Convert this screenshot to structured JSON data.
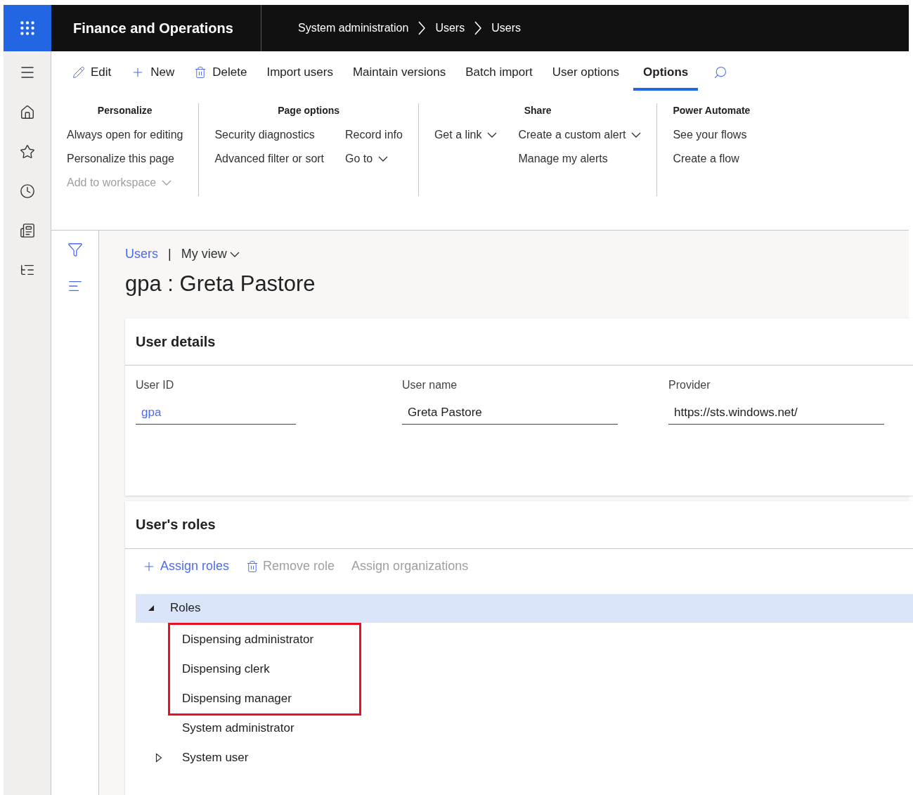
{
  "header": {
    "app_title": "Finance and Operations",
    "breadcrumb": [
      "System administration",
      "Users",
      "Users"
    ]
  },
  "action_pane": [
    {
      "label": "Edit",
      "kind": "edit",
      "selected": false
    },
    {
      "label": "New",
      "kind": "new",
      "selected": false
    },
    {
      "label": "Delete",
      "kind": "delete",
      "selected": false
    },
    {
      "label": "Import users",
      "kind": "text",
      "selected": false
    },
    {
      "label": "Maintain versions",
      "kind": "text",
      "selected": false
    },
    {
      "label": "Batch import",
      "kind": "text",
      "selected": false
    },
    {
      "label": "User options",
      "kind": "text",
      "selected": false
    },
    {
      "label": "Options",
      "kind": "text",
      "selected": true
    }
  ],
  "ribbon_groups": [
    {
      "title": "Personalize",
      "columns": [
        [
          {
            "label": "Always open for editing",
            "disabled": false,
            "dropdown": false
          },
          {
            "label": "Personalize this page",
            "disabled": false,
            "dropdown": false
          },
          {
            "label": "Add to workspace",
            "disabled": true,
            "dropdown": true
          }
        ]
      ]
    },
    {
      "title": "Page options",
      "columns": [
        [
          {
            "label": "Security diagnostics",
            "disabled": false,
            "dropdown": false
          },
          {
            "label": "Advanced filter or sort",
            "disabled": false,
            "dropdown": false
          }
        ],
        [
          {
            "label": "Record info",
            "disabled": false,
            "dropdown": false
          },
          {
            "label": "Go to",
            "disabled": false,
            "dropdown": true
          }
        ]
      ]
    },
    {
      "title": "Share",
      "columns": [
        [
          {
            "label": "Get a link",
            "disabled": false,
            "dropdown": true
          }
        ],
        [
          {
            "label": "Create a custom alert",
            "disabled": false,
            "dropdown": true
          },
          {
            "label": "Manage my alerts",
            "disabled": false,
            "dropdown": false
          }
        ]
      ]
    },
    {
      "title": "Power Automate",
      "columns": [
        [
          {
            "label": "See your flows",
            "disabled": false,
            "dropdown": false
          },
          {
            "label": "Create a flow",
            "disabled": false,
            "dropdown": false
          }
        ]
      ]
    }
  ],
  "page": {
    "breadcrumb_link": "Users",
    "separator": "|",
    "view": "My view",
    "title": "gpa : Greta Pastore"
  },
  "user_details": {
    "title": "User details",
    "fields": [
      {
        "label": "User ID",
        "value": "gpa",
        "link": true
      },
      {
        "label": "User name",
        "value": "Greta Pastore",
        "link": false
      },
      {
        "label": "Provider",
        "value": "https://sts.windows.net/",
        "link": false
      }
    ]
  },
  "users_roles": {
    "title": "User's roles",
    "toolbar": [
      {
        "label": "Assign roles",
        "kind": "new",
        "disabled": false
      },
      {
        "label": "Remove role",
        "kind": "delete",
        "disabled": true
      },
      {
        "label": "Assign organizations",
        "kind": "text",
        "disabled": true
      }
    ],
    "tree": [
      {
        "label": "Roles",
        "selected": true,
        "expanded": true,
        "children": [
          {
            "label": "Dispensing administrator",
            "selected": false,
            "highlighted": true
          },
          {
            "label": "Dispensing clerk",
            "selected": false,
            "highlighted": true
          },
          {
            "label": "Dispensing manager",
            "selected": false,
            "highlighted": true
          },
          {
            "label": "System administrator",
            "selected": false,
            "highlighted": false
          },
          {
            "label": "System user",
            "selected": false,
            "highlighted": false,
            "expanded": false
          }
        ]
      }
    ]
  }
}
